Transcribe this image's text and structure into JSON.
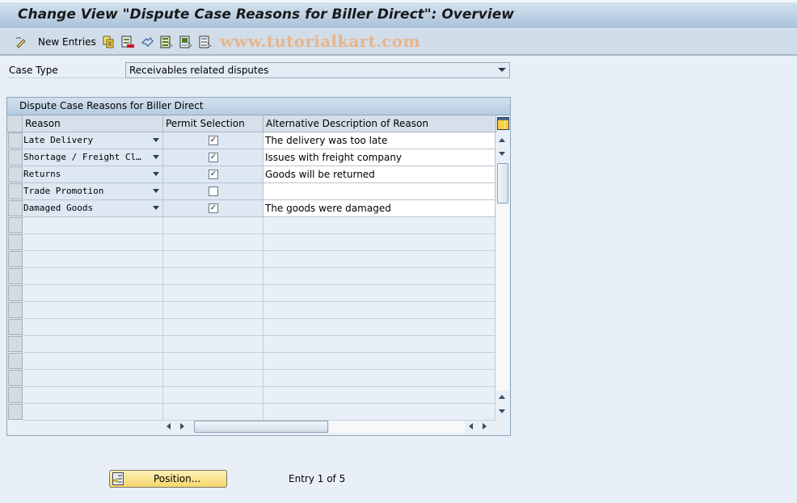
{
  "window": {
    "title": "Change View \"Dispute Case Reasons for Biller Direct\": Overview"
  },
  "toolbar": {
    "new_entries_label": "New Entries",
    "icons": [
      "edit-pencil-icon",
      "copy-icon",
      "delete-icon",
      "undo-icon",
      "select-all-icon",
      "select-block-icon",
      "deselect-all-icon"
    ],
    "watermark": "www.tutorialkart.com"
  },
  "case_type": {
    "label": "Case Type",
    "value": "Receivables related disputes"
  },
  "table": {
    "title": "Dispute Case Reasons for Biller Direct",
    "columns": [
      "Reason",
      "Permit Selection",
      "Alternative Description of Reason"
    ],
    "rows": [
      {
        "reason": "Late Delivery",
        "permit": true,
        "description": "The delivery was too late"
      },
      {
        "reason": "Shortage / Freight Cl…",
        "permit": true,
        "description": "Issues with freight company"
      },
      {
        "reason": "Returns",
        "permit": true,
        "description": "Goods will be returned"
      },
      {
        "reason": "Trade Promotion",
        "permit": false,
        "description": ""
      },
      {
        "reason": "Damaged Goods",
        "permit": true,
        "description": "The goods were damaged"
      }
    ],
    "empty_rows": 12
  },
  "footer": {
    "position_button": "Position...",
    "entry_info": "Entry 1 of 5"
  },
  "colors": {
    "title_gradient_top": "#d4e2ee",
    "title_gradient_bottom": "#a9c2da",
    "background": "#e8eff7",
    "position_button": "#f6d76c",
    "watermark": "#e8b58a"
  }
}
